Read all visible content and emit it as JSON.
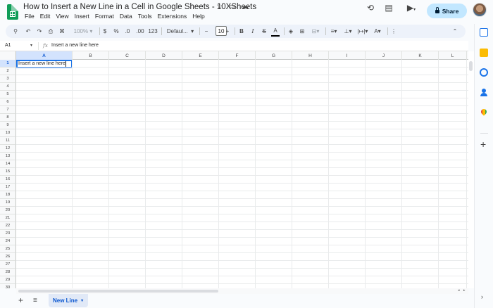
{
  "header": {
    "doc_title": "How to Insert a New Line in a Cell in Google Sheets - 10XSheets",
    "menu": [
      "File",
      "Edit",
      "View",
      "Insert",
      "Format",
      "Data",
      "Tools",
      "Extensions",
      "Help"
    ],
    "share_label": "Share"
  },
  "toolbar": {
    "zoom": "100%",
    "currency": "$",
    "percent": "%",
    "decrease_decimal": ".0",
    "increase_decimal": ".00",
    "number_format": "123",
    "font": "Defaul...",
    "font_size": "10",
    "bold": "B",
    "italic": "I",
    "text_color": "A"
  },
  "formula_bar": {
    "cell_ref": "A1",
    "fx": "fx",
    "content": "Insert a new line here"
  },
  "grid": {
    "columns": [
      "A",
      "B",
      "C",
      "D",
      "E",
      "F",
      "G",
      "H",
      "I",
      "J",
      "K",
      "L"
    ],
    "rows": [
      "1",
      "2",
      "3",
      "4",
      "5",
      "6",
      "7",
      "8",
      "9",
      "10",
      "11",
      "12",
      "13",
      "14",
      "15",
      "16",
      "17",
      "18",
      "19",
      "20",
      "21",
      "22",
      "23",
      "24",
      "25",
      "26",
      "27",
      "28",
      "29",
      "30"
    ],
    "selected_col": "A",
    "selected_row": "1",
    "active_cell_value": "Insert a new line here"
  },
  "sheets": {
    "active_tab": "New Line"
  },
  "colors": {
    "accent": "#1a73e8",
    "share_bg": "#c2e7ff",
    "sheets_green": "#0f9d58",
    "tab_bg": "#e1e9f7"
  }
}
